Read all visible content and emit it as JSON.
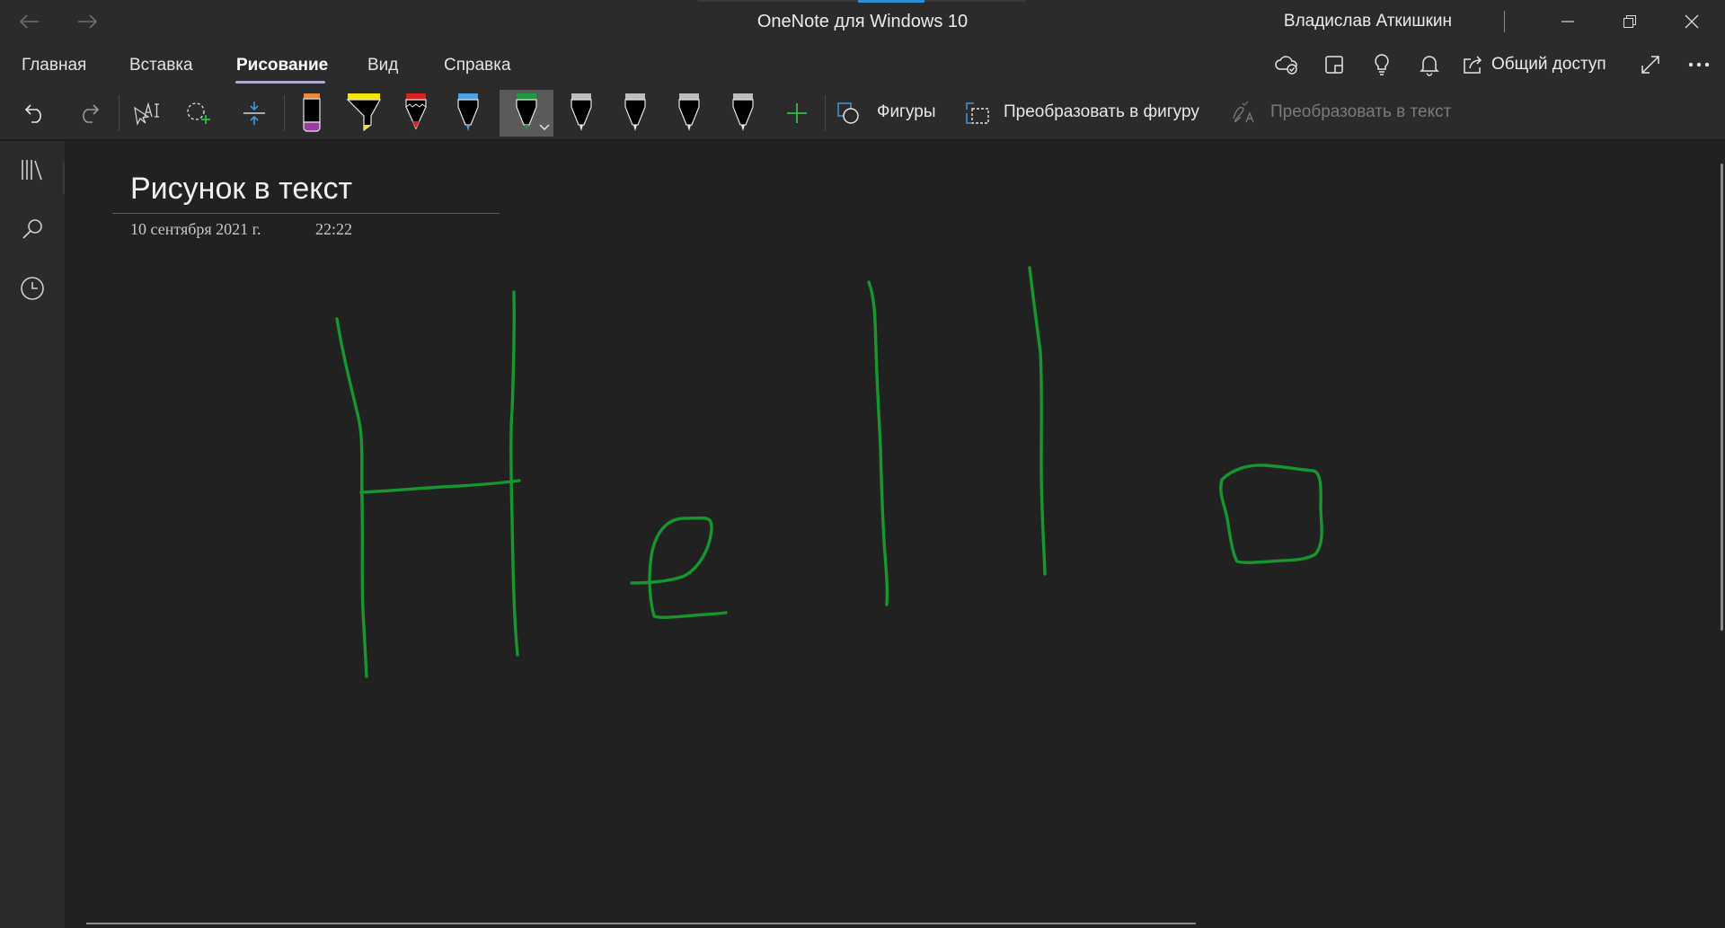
{
  "window": {
    "title": "OneNote для Windows 10",
    "user": "Владислав Аткишкин"
  },
  "tabs": [
    {
      "label": "Главная",
      "active": false
    },
    {
      "label": "Вставка",
      "active": false
    },
    {
      "label": "Рисование",
      "active": true
    },
    {
      "label": "Вид",
      "active": false
    },
    {
      "label": "Справка",
      "active": false
    }
  ],
  "header_actions": {
    "share_label": "Общий доступ"
  },
  "toolbar": {
    "shapes_label": "Фигуры",
    "ink_to_shape_label": "Преобразовать в фигуру",
    "ink_to_text_label": "Преобразовать в текст",
    "pens": [
      {
        "name": "marker-purple",
        "color": "#9b3aa3"
      },
      {
        "name": "highlighter-yellow",
        "color": "#f5e600"
      },
      {
        "name": "pencil-red",
        "color": "#e02020"
      },
      {
        "name": "pen-blue",
        "color": "#4aa3e8"
      },
      {
        "name": "pen-green",
        "color": "#1a9c3a",
        "selected": true
      },
      {
        "name": "pen-black-1",
        "color": "#000000"
      },
      {
        "name": "pen-black-2",
        "color": "#000000"
      },
      {
        "name": "pen-black-3",
        "color": "#000000"
      },
      {
        "name": "pen-black-4",
        "color": "#000000"
      }
    ]
  },
  "page": {
    "title": "Рисунок в текст",
    "date": "10 сентября 2021 г.",
    "time": "22:22",
    "ink_color": "#17952f"
  }
}
